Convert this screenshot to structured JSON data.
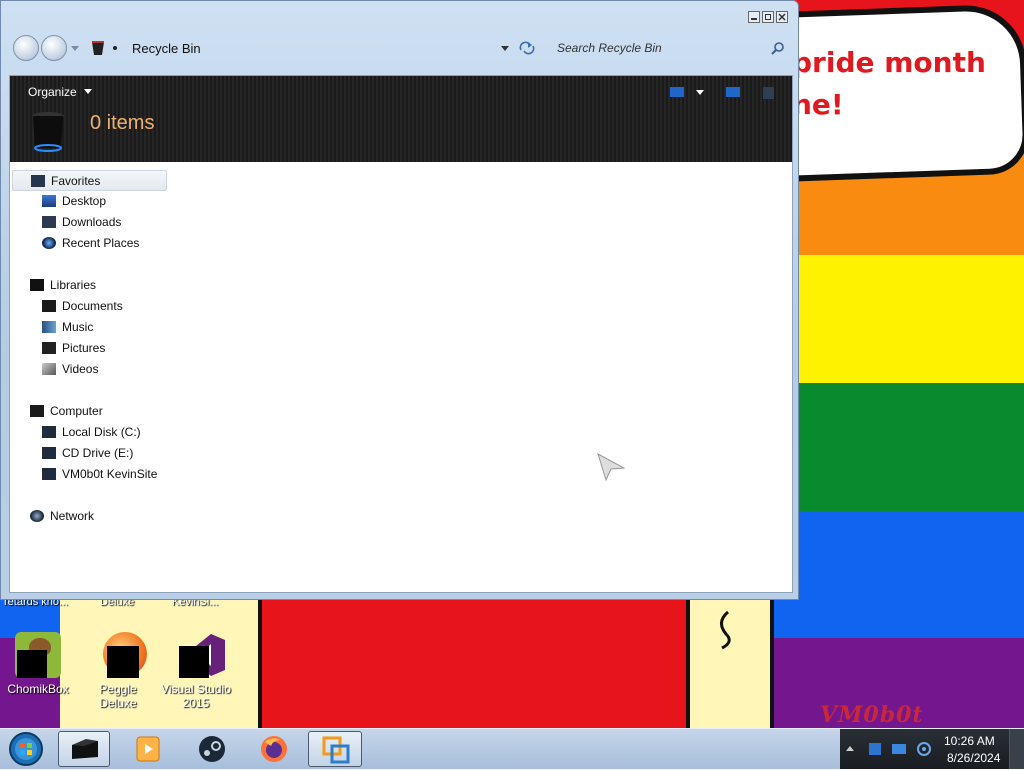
{
  "window": {
    "title": "Recycle Bin",
    "search_placeholder": "Search Recycle Bin",
    "toolbar": {
      "organize_label": "Organize",
      "item_count": "0 items"
    }
  },
  "navigation": {
    "favorites": {
      "label": "Favorites",
      "items": [
        "Desktop",
        "Downloads",
        "Recent Places"
      ]
    },
    "libraries": {
      "label": "Libraries",
      "items": [
        "Documents",
        "Music",
        "Pictures",
        "Videos"
      ]
    },
    "computer": {
      "label": "Computer",
      "items": [
        "Local Disk (C:)",
        "CD Drive (E:)",
        "VM0b0t KevinSite"
      ]
    },
    "network": {
      "label": "Network"
    }
  },
  "desktop": {
    "wallpaper_text": "pride month\nne!",
    "watermark": "VM0b0t",
    "partial_labels": [
      "retards kno...",
      "Deluxe",
      "KevinSi..."
    ],
    "icons": [
      {
        "label": "ChomikBox",
        "icon": "chomikbox-icon"
      },
      {
        "label": "Peggle Deluxe",
        "icon": "peggle-icon"
      },
      {
        "label": "Visual Studio 2015",
        "icon": "visual-studio-icon"
      }
    ]
  },
  "taskbar": {
    "pinned": [
      "recycle-bin-icon",
      "media-player-icon",
      "steam-icon",
      "firefox-icon",
      "vmware-icon"
    ],
    "time": "10:26 AM",
    "date": "8/26/2024"
  },
  "colors": {
    "item_count": "#f0b070",
    "speech_text": "#e01920"
  }
}
